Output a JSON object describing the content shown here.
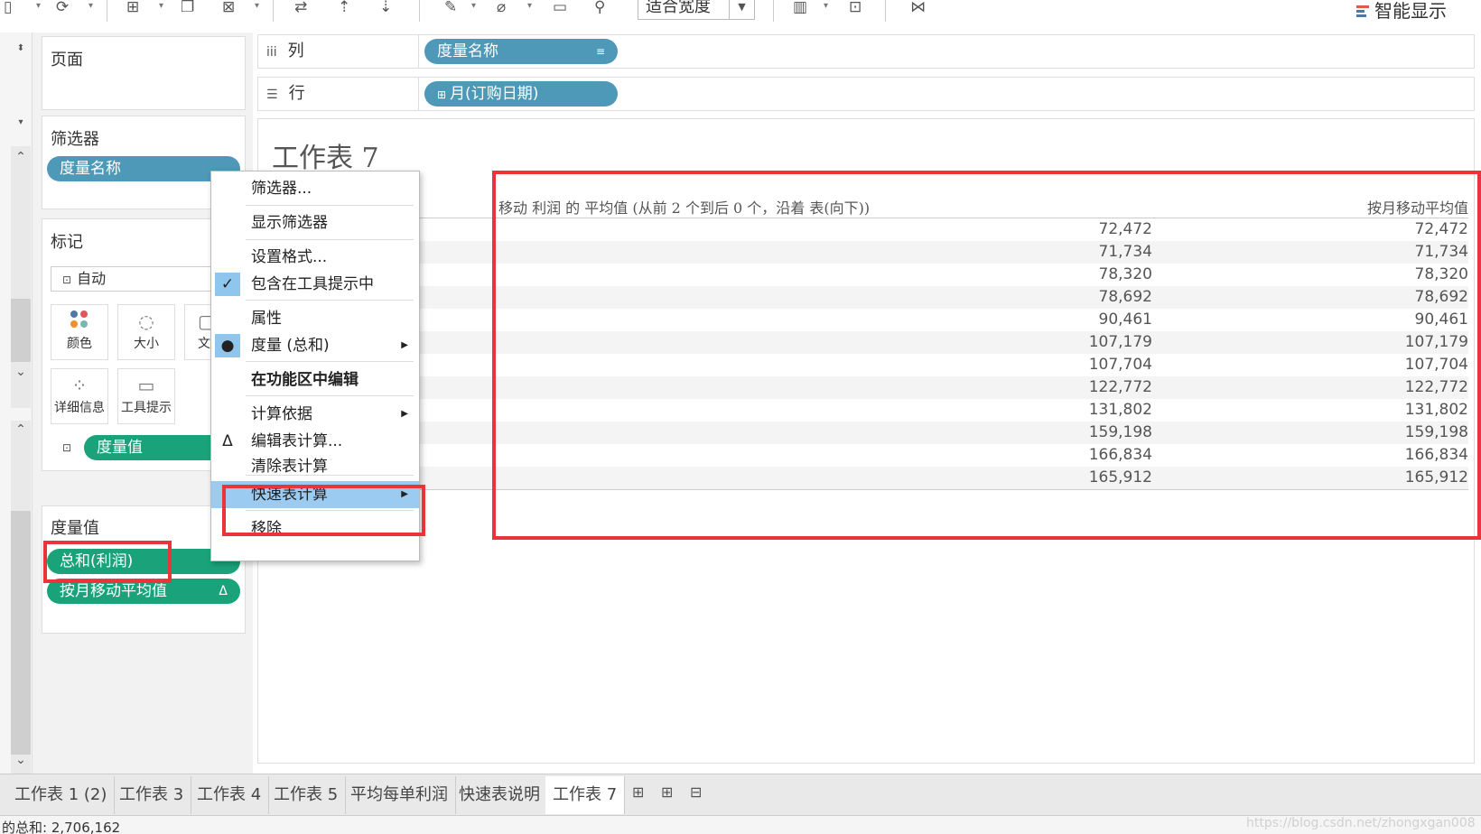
{
  "toolbar": {
    "fit_mode": "适合宽度",
    "smart_show": "智能显示"
  },
  "cards": {
    "pages_title": "页面",
    "filters_title": "筛选器",
    "filter_pill": "度量名称",
    "marks_title": "标记",
    "mark_type": "自动",
    "mark_buttons": [
      {
        "label": "颜色",
        "icon": "color-dots-icon"
      },
      {
        "label": "大小",
        "icon": "size-icon"
      },
      {
        "label": "文",
        "icon": "text-icon"
      },
      {
        "label": "详细信息",
        "icon": "detail-icon"
      },
      {
        "label": "工具提示",
        "icon": "tooltip-icon"
      }
    ],
    "marks_pill": "度量值",
    "measure_values_title": "度量值",
    "measure_pills": [
      "总和(利润)",
      "按月移动平均值"
    ]
  },
  "shelves": {
    "columns_label": "列",
    "columns_pill": "度量名称",
    "rows_label": "行",
    "rows_pill": "月(订购日期)"
  },
  "view": {
    "sheet_title": "工作表 7",
    "col_header_1": "移动 利润 的 平均值 (从前 2 个到后 0 个，沿着 表(向下))",
    "col_header_2": "按月移动平均值",
    "rows": [
      [
        "72,472",
        "72,472"
      ],
      [
        "71,734",
        "71,734"
      ],
      [
        "78,320",
        "78,320"
      ],
      [
        "78,692",
        "78,692"
      ],
      [
        "90,461",
        "90,461"
      ],
      [
        "107,179",
        "107,179"
      ],
      [
        "107,704",
        "107,704"
      ],
      [
        "122,772",
        "122,772"
      ],
      [
        "131,802",
        "131,802"
      ],
      [
        "159,198",
        "159,198"
      ],
      [
        "166,834",
        "166,834"
      ],
      [
        "165,912",
        "165,912"
      ]
    ]
  },
  "context_menu": {
    "items": [
      {
        "label": "筛选器...",
        "check": "",
        "submenu": false,
        "bold": false,
        "highlight": false
      },
      {
        "label": "显示筛选器",
        "check": "",
        "submenu": false,
        "bold": false,
        "highlight": false
      },
      {
        "label": "设置格式...",
        "check": "",
        "submenu": false,
        "bold": false,
        "highlight": false
      },
      {
        "label": "包含在工具提示中",
        "check": "✓",
        "submenu": false,
        "bold": false,
        "highlight": false
      },
      {
        "label": "属性",
        "check": "",
        "submenu": false,
        "bold": false,
        "highlight": false
      },
      {
        "label": "度量 (总和)",
        "check": "●",
        "submenu": true,
        "bold": false,
        "highlight": false
      },
      {
        "label": "在功能区中编辑",
        "check": "",
        "submenu": false,
        "bold": true,
        "highlight": false
      },
      {
        "label": "计算依据",
        "check": "",
        "submenu": true,
        "bold": false,
        "highlight": false
      },
      {
        "label": "编辑表计算...",
        "check": "Δ",
        "submenu": false,
        "bold": false,
        "highlight": false
      },
      {
        "label": "清除表计算",
        "check": "",
        "submenu": false,
        "bold": false,
        "highlight": false
      },
      {
        "label": "快速表计算",
        "check": "",
        "submenu": true,
        "bold": false,
        "highlight": true
      },
      {
        "label": "移除",
        "check": "",
        "submenu": false,
        "bold": false,
        "highlight": false
      }
    ]
  },
  "tabs": [
    "工作表 1 (2)",
    "工作表 3",
    "工作表 4",
    "工作表 5",
    "平均每单利润",
    "快速表说明",
    "工作表 7"
  ],
  "active_tab": "工作表 7",
  "status": {
    "text": "的总和: 2,706,162",
    "watermark": "https://blog.csdn.net/zhongxgan008"
  },
  "colors": {
    "blue_pill": "#4e98b8",
    "green_pill": "#1aa37a",
    "highlight_red": "#e8343a",
    "menu_highlight": "#9bcbf0"
  }
}
